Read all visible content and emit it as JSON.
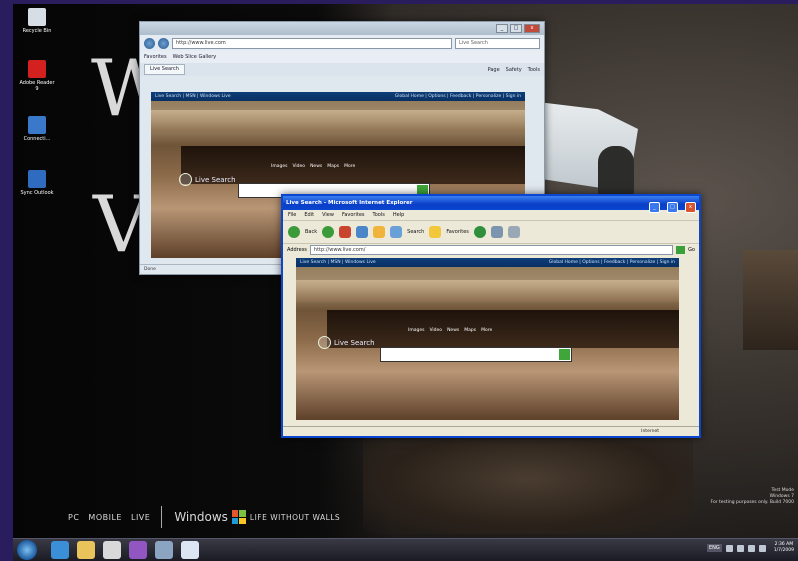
{
  "desktop": {
    "wallpaper_letters": [
      "W",
      "V"
    ],
    "icons": [
      {
        "label": "Recycle Bin",
        "color": "#d6dde4"
      },
      {
        "label": "Adobe Reader 9",
        "color": "#d3211f"
      },
      {
        "label": "Connecti...",
        "color": "#3a78c9"
      },
      {
        "label": "Sync Outlook",
        "color": "#2f6bbf"
      }
    ]
  },
  "window_back": {
    "address": "http://www.live.com",
    "search_placeholder": "Live Search",
    "favorites_label": "Favorites",
    "web_slice_label": "Web Slice Gallery",
    "tab_label": "Live Search",
    "toolbar_items": [
      "Page",
      "Safety",
      "Tools"
    ],
    "site_bar_left": "Live Search | MSN | Windows Live",
    "site_bar_right": "Global Home | Options | Feedback | Personalize | Sign in",
    "brand": "Live Search",
    "categories": [
      "Images",
      "Video",
      "News",
      "Maps",
      "More"
    ],
    "status": "Done"
  },
  "window_front": {
    "title": "Live Search - Microsoft Internet Explorer",
    "menu": [
      "File",
      "Edit",
      "View",
      "Favorites",
      "Tools",
      "Help"
    ],
    "toolbar": [
      "Back",
      "Search",
      "Favorites"
    ],
    "address_label": "Address",
    "address": "http://www.live.com/",
    "go_label": "Go",
    "site_bar_left": "Live Search | MSN | Windows Live",
    "site_bar_right": "Global Home | Options | Feedback | Personalize | Sign in",
    "brand": "Live Search",
    "categories": [
      "Images",
      "Video",
      "News",
      "Maps",
      "More"
    ],
    "status": "Internet"
  },
  "branding": {
    "nav": [
      "PC",
      "MOBILE",
      "LIVE"
    ],
    "product": "Windows",
    "tagline": "LIFE WITHOUT WALLS"
  },
  "notice": {
    "line1": "Test Mode",
    "line2": "Windows 7",
    "line3": "For testing purposes only. Build 7000"
  },
  "taskbar": {
    "buttons": [
      {
        "name": "ie",
        "color": "#3b8fd6"
      },
      {
        "name": "explorer",
        "color": "#e8c45a"
      },
      {
        "name": "media",
        "color": "#d9d9d9"
      },
      {
        "name": "onenote",
        "color": "#9156c2"
      },
      {
        "name": "window-switcher",
        "color": "#8aa4c2"
      },
      {
        "name": "document",
        "color": "#dbe6f2"
      }
    ],
    "language": "ENG",
    "time": "2:36 AM",
    "date": "1/7/2009"
  }
}
